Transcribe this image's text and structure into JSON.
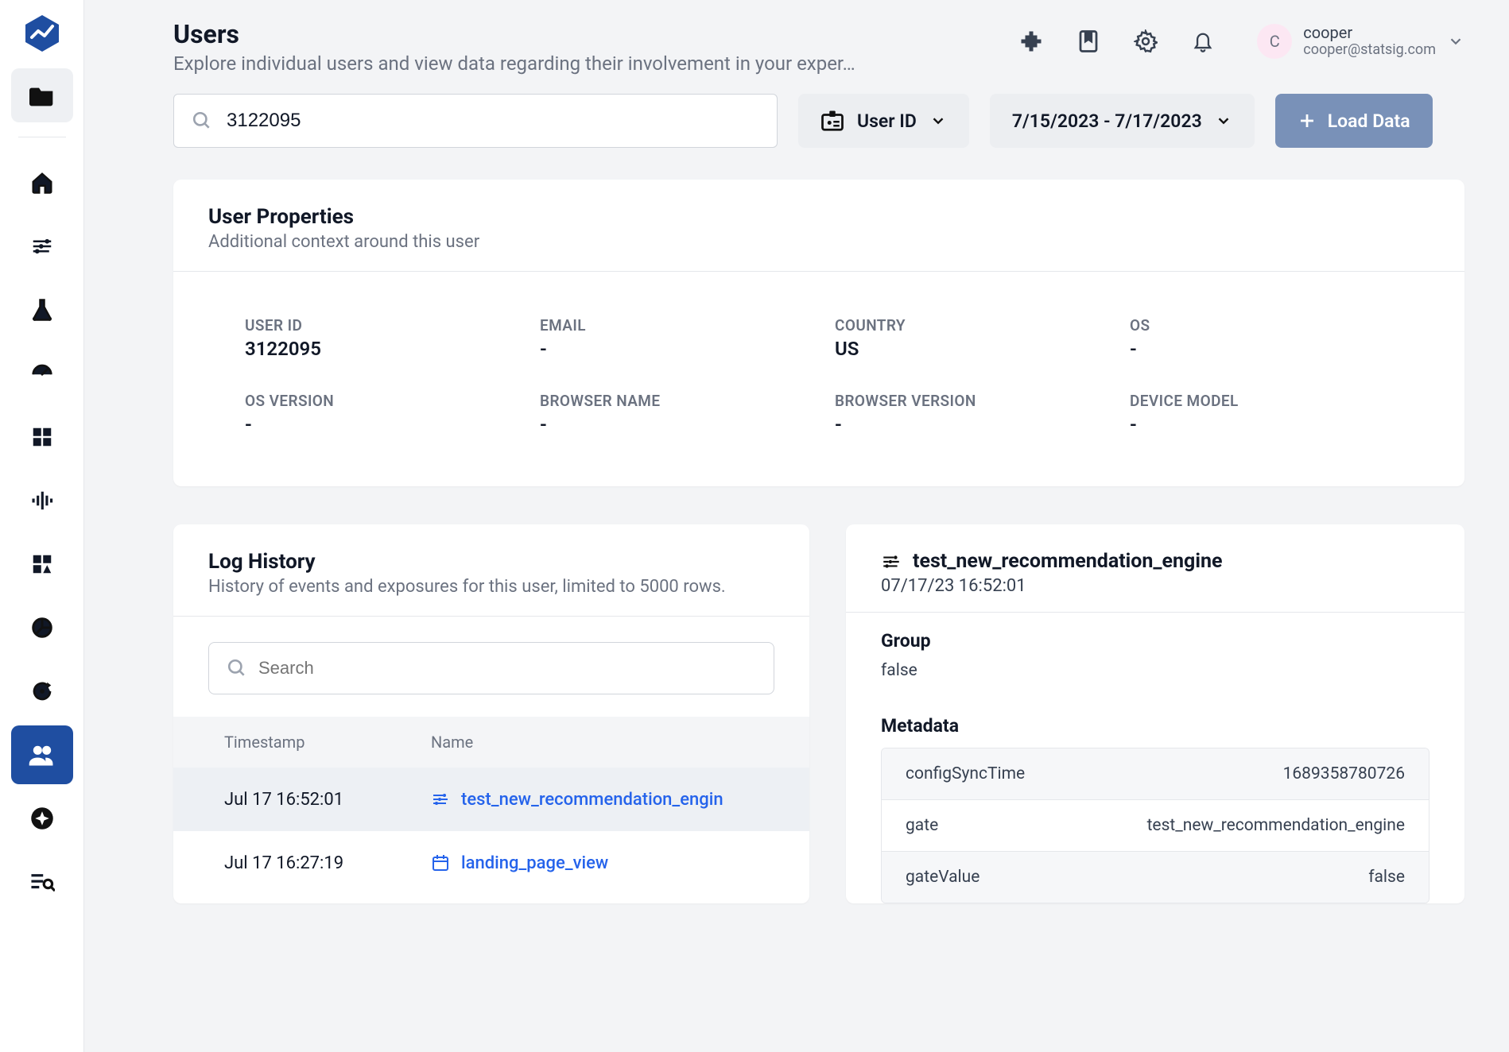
{
  "header": {
    "title": "Users",
    "subtitle": "Explore individual users and view data regarding their involvement in your exper…",
    "user": {
      "initial": "C",
      "name": "cooper",
      "email": "cooper@statsig.com"
    }
  },
  "filters": {
    "search_value": "3122095",
    "id_type_label": "User ID",
    "date_range_label": "7/15/2023 - 7/17/2023",
    "load_button_label": "Load Data"
  },
  "user_properties": {
    "title": "User Properties",
    "subtitle": "Additional context around this user",
    "fields": [
      {
        "label": "USER ID",
        "value": "3122095"
      },
      {
        "label": "EMAIL",
        "value": "-"
      },
      {
        "label": "COUNTRY",
        "value": "US"
      },
      {
        "label": "OS",
        "value": "-"
      },
      {
        "label": "OS VERSION",
        "value": "-"
      },
      {
        "label": "BROWSER NAME",
        "value": "-"
      },
      {
        "label": "BROWSER VERSION",
        "value": "-"
      },
      {
        "label": "DEVICE MODEL",
        "value": "-"
      }
    ]
  },
  "log_history": {
    "title": "Log History",
    "subtitle": "History of events and exposures for this user, limited to 5000 rows.",
    "search_placeholder": "Search",
    "columns": {
      "timestamp": "Timestamp",
      "name": "Name"
    },
    "rows": [
      {
        "timestamp": "Jul 17 16:52:01",
        "name": "test_new_recommendation_engin",
        "icon": "sliders",
        "selected": true
      },
      {
        "timestamp": "Jul 17 16:27:19",
        "name": "landing_page_view",
        "icon": "calendar",
        "selected": false
      }
    ]
  },
  "detail": {
    "title": "test_new_recommendation_engine",
    "timestamp": "07/17/23 16:52:01",
    "group_label": "Group",
    "group_value": "false",
    "metadata_label": "Metadata",
    "metadata": [
      {
        "key": "configSyncTime",
        "value": "1689358780726"
      },
      {
        "key": "gate",
        "value": "test_new_recommendation_engine"
      },
      {
        "key": "gateValue",
        "value": "false"
      }
    ]
  }
}
